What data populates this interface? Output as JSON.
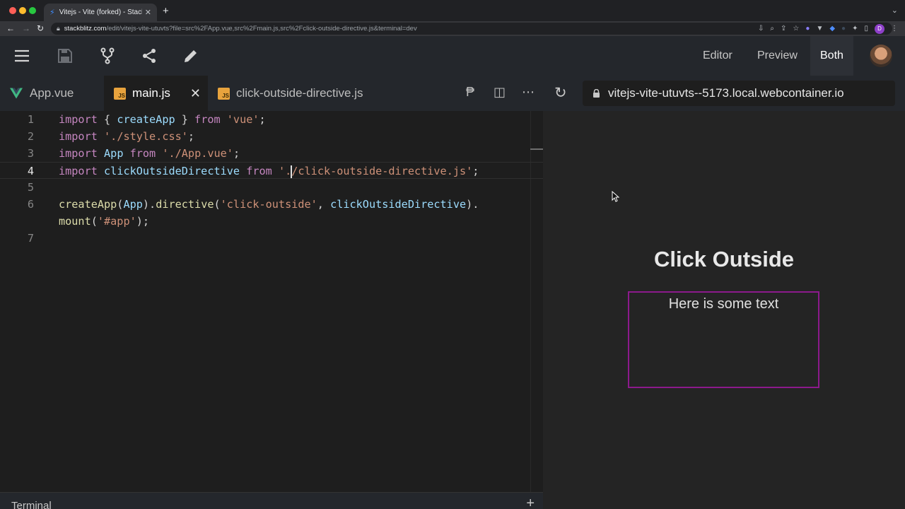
{
  "browser": {
    "tab_title": "Vitejs - Vite (forked) - StackBl",
    "url_domain": "stackblitz.com",
    "url_path": "/edit/vitejs-vite-utuvts?file=src%2FApp.vue,src%2Fmain.js,src%2Fclick-outside-directive.js&terminal=dev",
    "profile_initial": "D"
  },
  "header": {
    "view_editor": "Editor",
    "view_preview": "Preview",
    "view_both": "Both",
    "active_view": "Both"
  },
  "tabs": [
    {
      "label": "App.vue",
      "icon": "vue-icon",
      "active": false
    },
    {
      "label": "main.js",
      "icon": "js-icon",
      "active": true
    },
    {
      "label": "click-outside-directive.js",
      "icon": "js-icon",
      "active": false
    }
  ],
  "js_badge_text": "JS",
  "preview_url": "vitejs-vite-utuvts--5173.local.webcontainer.io",
  "line_numbers": [
    "1",
    "2",
    "3",
    "4",
    "5",
    "6",
    "",
    "7"
  ],
  "code_lines": [
    [
      {
        "t": "import",
        "c": "kw"
      },
      {
        "t": " { ",
        "c": "pl"
      },
      {
        "t": "createApp",
        "c": "id"
      },
      {
        "t": " } ",
        "c": "pl"
      },
      {
        "t": "from",
        "c": "kw"
      },
      {
        "t": " ",
        "c": "pl"
      },
      {
        "t": "'vue'",
        "c": "str"
      },
      {
        "t": ";",
        "c": "pl"
      }
    ],
    [
      {
        "t": "import",
        "c": "kw"
      },
      {
        "t": " ",
        "c": "pl"
      },
      {
        "t": "'./style.css'",
        "c": "str"
      },
      {
        "t": ";",
        "c": "pl"
      }
    ],
    [
      {
        "t": "import",
        "c": "kw"
      },
      {
        "t": " ",
        "c": "pl"
      },
      {
        "t": "App",
        "c": "id"
      },
      {
        "t": " ",
        "c": "pl"
      },
      {
        "t": "from",
        "c": "kw"
      },
      {
        "t": " ",
        "c": "pl"
      },
      {
        "t": "'./App.vue'",
        "c": "str"
      },
      {
        "t": ";",
        "c": "pl"
      }
    ],
    [
      {
        "t": "import",
        "c": "kw"
      },
      {
        "t": " ",
        "c": "pl"
      },
      {
        "t": "clickOutsideDirective",
        "c": "id"
      },
      {
        "t": " ",
        "c": "pl"
      },
      {
        "t": "from",
        "c": "kw"
      },
      {
        "t": " ",
        "c": "pl"
      },
      {
        "t": "'.",
        "c": "str"
      },
      {
        "t": "",
        "c": "cursor"
      },
      {
        "t": "/click-outside-directive.js'",
        "c": "str"
      },
      {
        "t": ";",
        "c": "pl"
      }
    ],
    [],
    [
      {
        "t": "createApp",
        "c": "fn"
      },
      {
        "t": "(",
        "c": "pl"
      },
      {
        "t": "App",
        "c": "id"
      },
      {
        "t": ").",
        "c": "pl"
      },
      {
        "t": "directive",
        "c": "fn"
      },
      {
        "t": "(",
        "c": "pl"
      },
      {
        "t": "'click-outside'",
        "c": "str"
      },
      {
        "t": ", ",
        "c": "pl"
      },
      {
        "t": "clickOutsideDirective",
        "c": "id"
      },
      {
        "t": ").",
        "c": "pl"
      }
    ],
    [
      {
        "t": "mount",
        "c": "fn"
      },
      {
        "t": "(",
        "c": "pl"
      },
      {
        "t": "'#app'",
        "c": "str"
      },
      {
        "t": ");",
        "c": "pl"
      }
    ],
    []
  ],
  "current_line": "4",
  "terminal_label": "Terminal",
  "preview_content": {
    "title": "Click Outside",
    "box_text": "Here is some text",
    "box_border_color": "#8c1a8c"
  }
}
